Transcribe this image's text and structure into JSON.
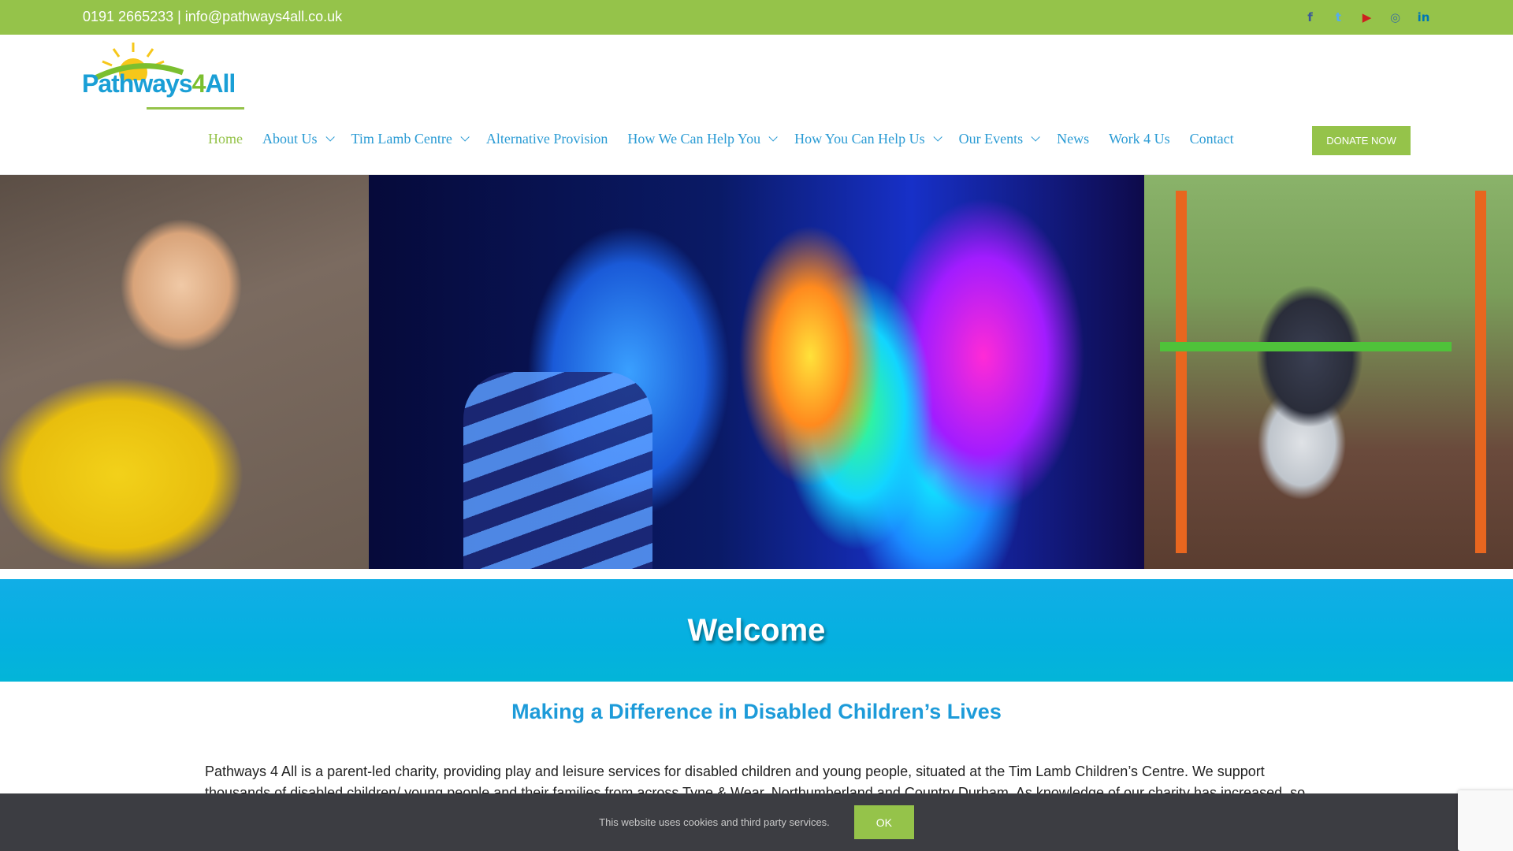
{
  "topbar": {
    "contact": "0191 2665233 | info@pathways4all.co.uk",
    "social": [
      {
        "icon": "facebook-icon",
        "glyph": "f",
        "color": "#3b5998"
      },
      {
        "icon": "twitter-icon",
        "glyph": "t",
        "color": "#55acee"
      },
      {
        "icon": "youtube-icon",
        "glyph": "▶",
        "color": "#cd201f"
      },
      {
        "icon": "instagram-icon",
        "glyph": "◎",
        "color": "#3f729b"
      },
      {
        "icon": "linkedin-icon",
        "glyph": "in",
        "color": "#0077b5"
      }
    ]
  },
  "logo": {
    "text_main": "Pathways",
    "text_num": "4",
    "text_tail": "All"
  },
  "nav": {
    "items": [
      {
        "label": "Home",
        "active": true,
        "dropdown": false
      },
      {
        "label": "About Us",
        "active": false,
        "dropdown": true
      },
      {
        "label": "Tim Lamb Centre",
        "active": false,
        "dropdown": true
      },
      {
        "label": "Alternative Provision",
        "active": false,
        "dropdown": false
      },
      {
        "label": "How We Can Help You",
        "active": false,
        "dropdown": true
      },
      {
        "label": "How You Can Help Us",
        "active": false,
        "dropdown": true
      },
      {
        "label": "Our Events",
        "active": false,
        "dropdown": true
      },
      {
        "label": "News",
        "active": false,
        "dropdown": false
      },
      {
        "label": "Work 4 Us",
        "active": false,
        "dropdown": false
      },
      {
        "label": "Contact",
        "active": false,
        "dropdown": false
      }
    ],
    "donate_label": "DONATE NOW"
  },
  "welcome": {
    "title": "Welcome"
  },
  "content": {
    "subheading": "Making a Difference in Disabled Children’s Lives",
    "paragraph": "Pathways 4 All is a parent-led charity, providing play and leisure services for disabled children and young people, situated at the Tim Lamb Children’s Centre.  We support thousands of disabled children/ young people and their families from across Tyne & Wear, Northumberland and Country Durham.  As knowledge of our charity has increased, so"
  },
  "cookie": {
    "message": "This website uses cookies and third party services.",
    "ok_label": "OK"
  },
  "colors": {
    "brand_green": "#95c34a",
    "brand_blue": "#2a9bd4",
    "welcome_band": "#05b0e0"
  }
}
